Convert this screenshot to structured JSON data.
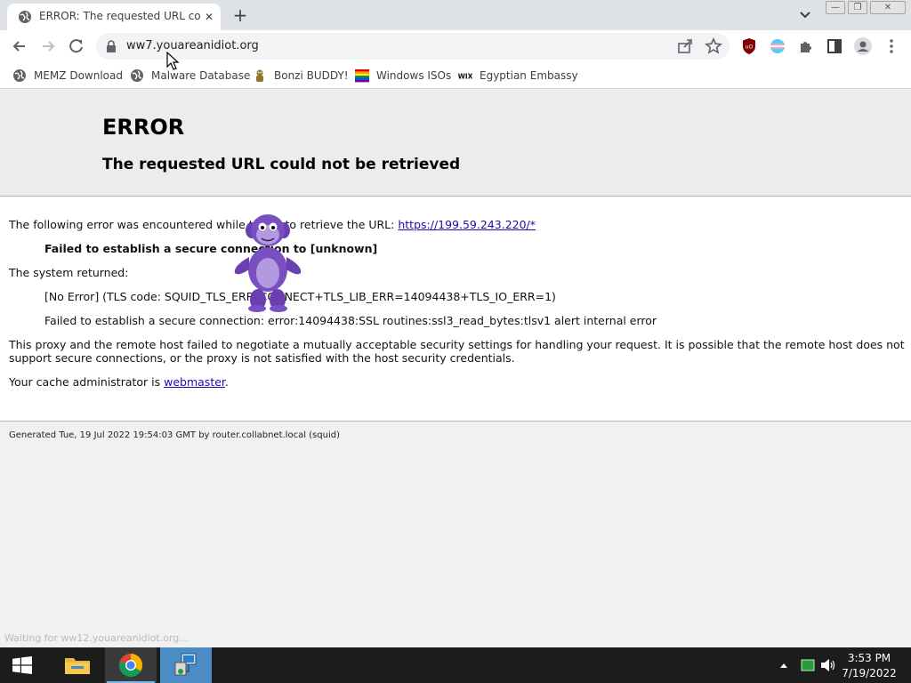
{
  "tab": {
    "title": "ERROR: The requested URL could not be retrieved"
  },
  "toolbar": {
    "url": "ww7.youareanidiot.org"
  },
  "bookmarks": [
    {
      "label": "MEMZ Download",
      "icon": "globe-icon"
    },
    {
      "label": "Malware Database",
      "icon": "globe-icon"
    },
    {
      "label": "Bonzi BUDDY!",
      "icon": "bonzi-icon"
    },
    {
      "label": "Windows ISOs",
      "icon": "rainbow-flag-icon"
    },
    {
      "label": "Egyptian Embassy",
      "icon": "wix-icon"
    }
  ],
  "page": {
    "title": "ERROR",
    "subtitle": "The requested URL could not be retrieved",
    "intro": "The following error was encountered while trying to retrieve the URL: ",
    "intro_link": "https://199.59.243.220/*",
    "failure": "Failed to establish a secure connection to [unknown]",
    "system_returned": "The system returned:",
    "tls_code": "[No Error] (TLS code: SQUID_TLS_ERR_CONNECT+TLS_LIB_ERR=14094438+TLS_IO_ERR=1)",
    "ssl_error": "Failed to establish a secure connection: error:14094438:SSL routines:ssl3_read_bytes:tlsv1 alert internal error",
    "explanation_1": "This proxy and the remote host failed to negotiate a mutually acceptable security settings for handling your request. It is possible that the remote host does not",
    "explanation_2": "support secure connections, or the proxy is not satisfied with the host security credentials.",
    "admin_prefix": "Your cache administrator is ",
    "admin_link": "webmaster",
    "admin_suffix": ".",
    "footer": "Generated Tue, 19 Jul 2022 19:54:03 GMT by router.collabnet.local (squid)"
  },
  "status_bar": {
    "text": "Waiting for ww12.youareanidiot.org..."
  },
  "taskbar": {
    "apps": [
      {
        "name": "file-explorer",
        "icon": "folder-icon"
      },
      {
        "name": "chrome",
        "icon": "chrome-icon"
      },
      {
        "name": "network-app",
        "icon": "network-icon"
      }
    ],
    "time": "3:53 PM",
    "date": "7/19/2022"
  },
  "colors": {
    "link": "#1a0dab",
    "taskbar": "#1c1c1c",
    "bonzi": "#7a4fc2"
  }
}
